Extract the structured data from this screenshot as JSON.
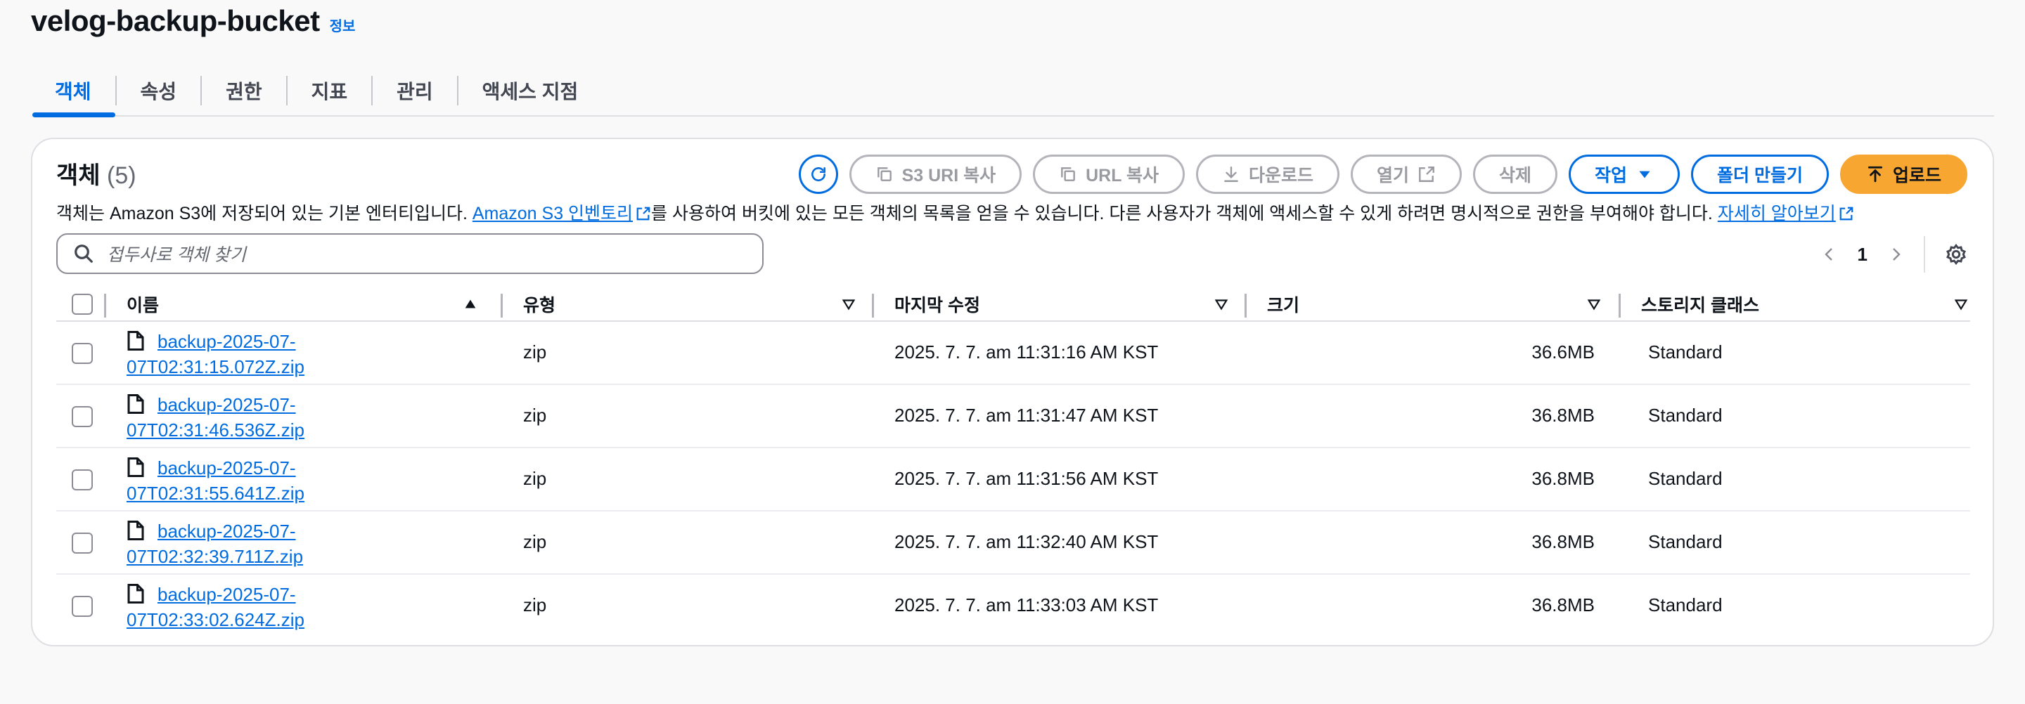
{
  "bucket": {
    "title": "velog-backup-bucket",
    "info_label": "정보"
  },
  "tabs": [
    {
      "label": "객체",
      "active": true
    },
    {
      "label": "속성"
    },
    {
      "label": "권한"
    },
    {
      "label": "지표"
    },
    {
      "label": "관리"
    },
    {
      "label": "액세스 지점"
    }
  ],
  "objects": {
    "heading": "객체",
    "count": "(5)",
    "desc_before": "객체는 Amazon S3에 저장되어 있는 기본 엔터티입니다. ",
    "desc_link1": "Amazon S3 인벤토리",
    "desc_middle": "를 사용하여 버킷에 있는 모든 객체의 목록을 얻을 수 있습니다. 다른 사용자가 객체에 액세스할 수 있게 하려면 명시적으로 권한을 부여해야 합니다. ",
    "desc_link2": "자세히 알아보기"
  },
  "toolbar": {
    "copy_s3_uri": "S3 URI 복사",
    "copy_url": "URL 복사",
    "download": "다운로드",
    "open": "열기",
    "delete": "삭제",
    "actions": "작업",
    "create_folder": "폴더 만들기",
    "upload": "업로드"
  },
  "search": {
    "placeholder": "접두사로 객체 찾기"
  },
  "pagination": {
    "current_page": "1"
  },
  "table": {
    "headers": {
      "name": "이름",
      "type": "유형",
      "modified": "마지막 수정",
      "size": "크기",
      "storage": "스토리지 클래스"
    },
    "rows": [
      {
        "name_l1": "backup-2025-07-",
        "name_l2": "07T02:31:15.072Z.zip",
        "type": "zip",
        "modified": "2025. 7. 7. am 11:31:16 AM KST",
        "size": "36.6MB",
        "storage": "Standard"
      },
      {
        "name_l1": "backup-2025-07-",
        "name_l2": "07T02:31:46.536Z.zip",
        "type": "zip",
        "modified": "2025. 7. 7. am 11:31:47 AM KST",
        "size": "36.8MB",
        "storage": "Standard"
      },
      {
        "name_l1": "backup-2025-07-",
        "name_l2": "07T02:31:55.641Z.zip",
        "type": "zip",
        "modified": "2025. 7. 7. am 11:31:56 AM KST",
        "size": "36.8MB",
        "storage": "Standard"
      },
      {
        "name_l1": "backup-2025-07-",
        "name_l2": "07T02:32:39.711Z.zip",
        "type": "zip",
        "modified": "2025. 7. 7. am 11:32:40 AM KST",
        "size": "36.8MB",
        "storage": "Standard"
      },
      {
        "name_l1": "backup-2025-07-",
        "name_l2": "07T02:33:02.624Z.zip",
        "type": "zip",
        "modified": "2025. 7. 7. am 11:33:03 AM KST",
        "size": "36.8MB",
        "storage": "Standard"
      }
    ]
  },
  "colors": {
    "accent": "#006ce0",
    "upload": "#f7a632",
    "text": "#0f141a",
    "muted": "#8c8c94"
  }
}
